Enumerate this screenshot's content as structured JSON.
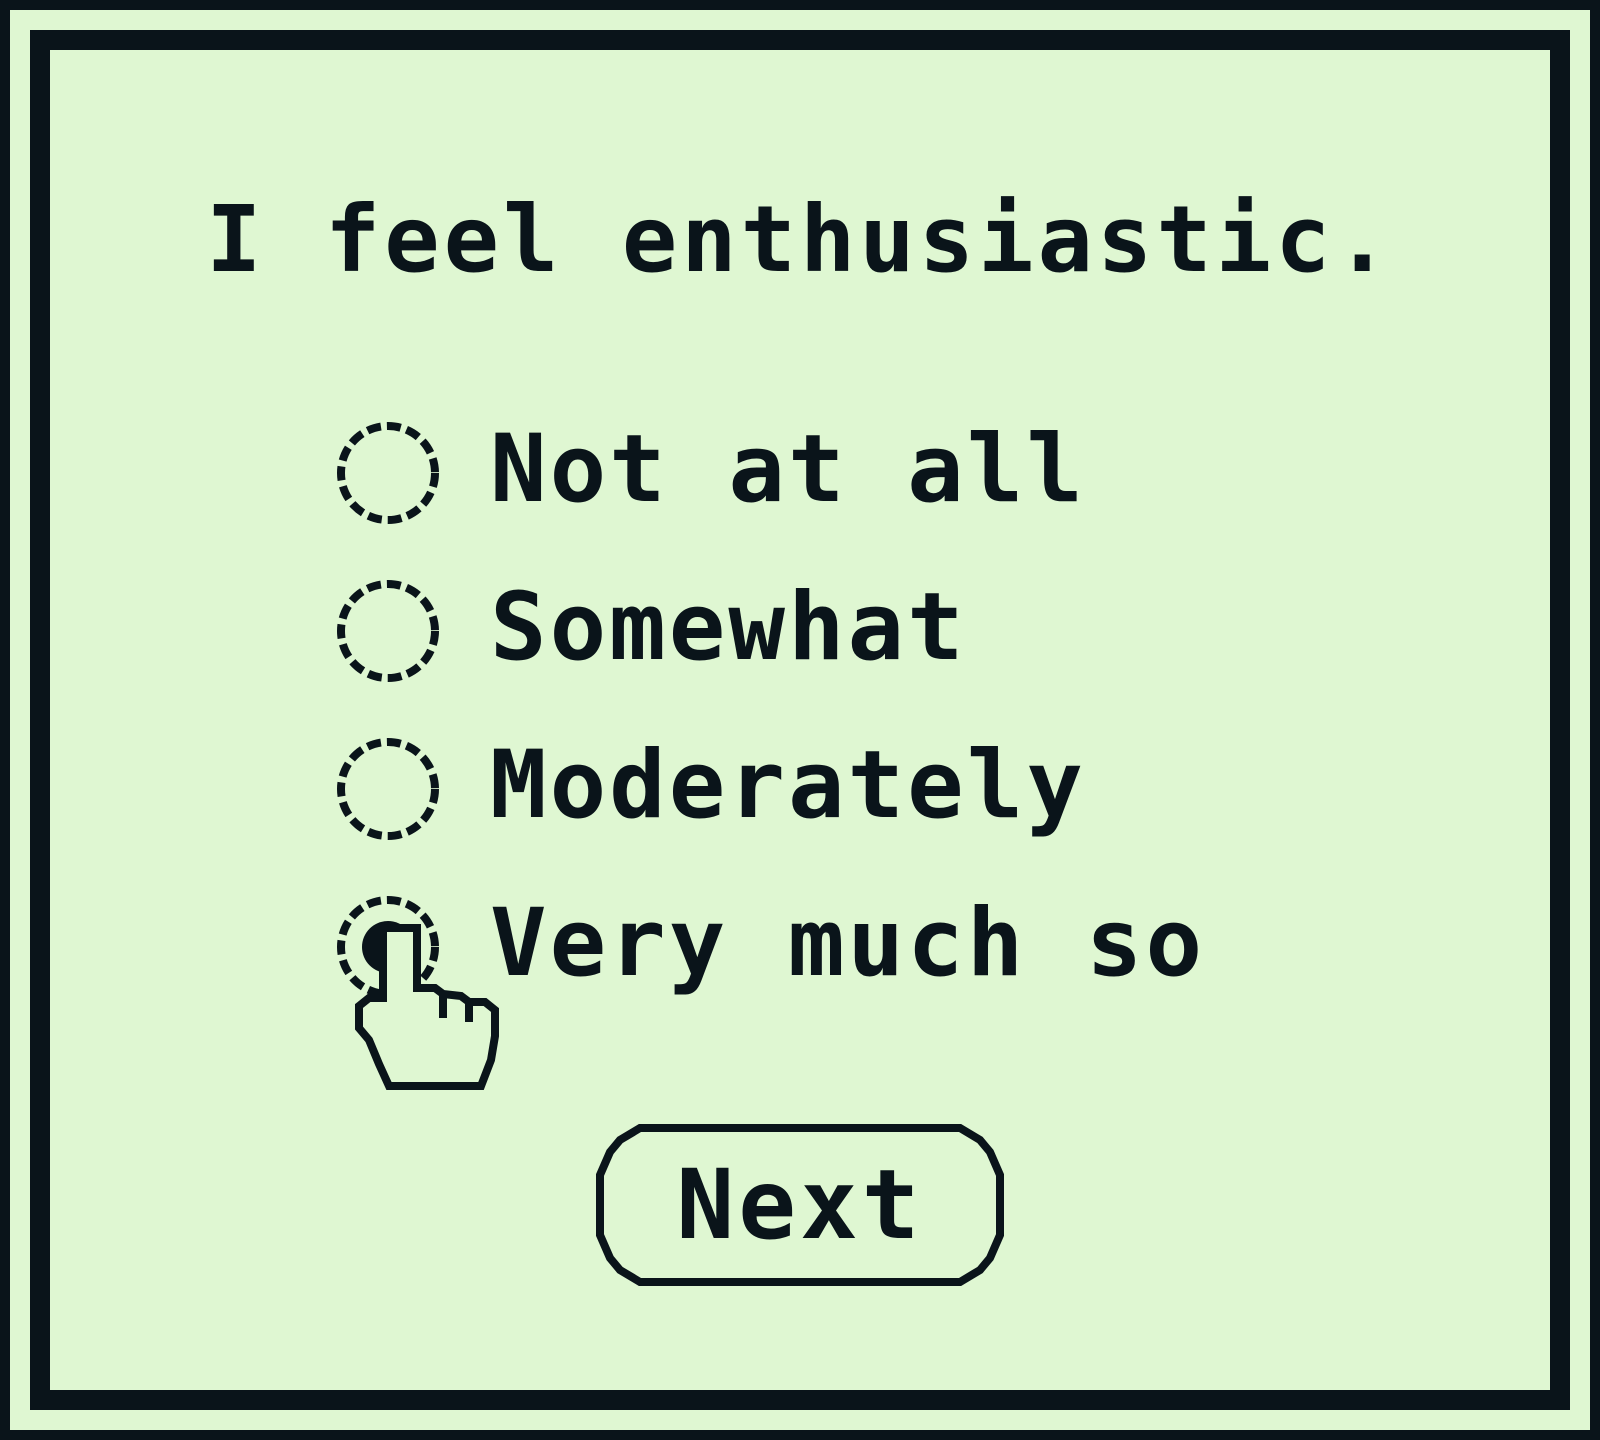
{
  "question": "I feel enthusiastic.",
  "options": [
    {
      "label": "Not at all",
      "selected": false
    },
    {
      "label": "Somewhat",
      "selected": false
    },
    {
      "label": "Moderately",
      "selected": false
    },
    {
      "label": "Very much so",
      "selected": true
    }
  ],
  "next_button": {
    "label": "Next"
  },
  "cursor_icon": "pointing-hand-icon",
  "colors": {
    "background": "#dff7d2",
    "ink": "#0a141a"
  }
}
